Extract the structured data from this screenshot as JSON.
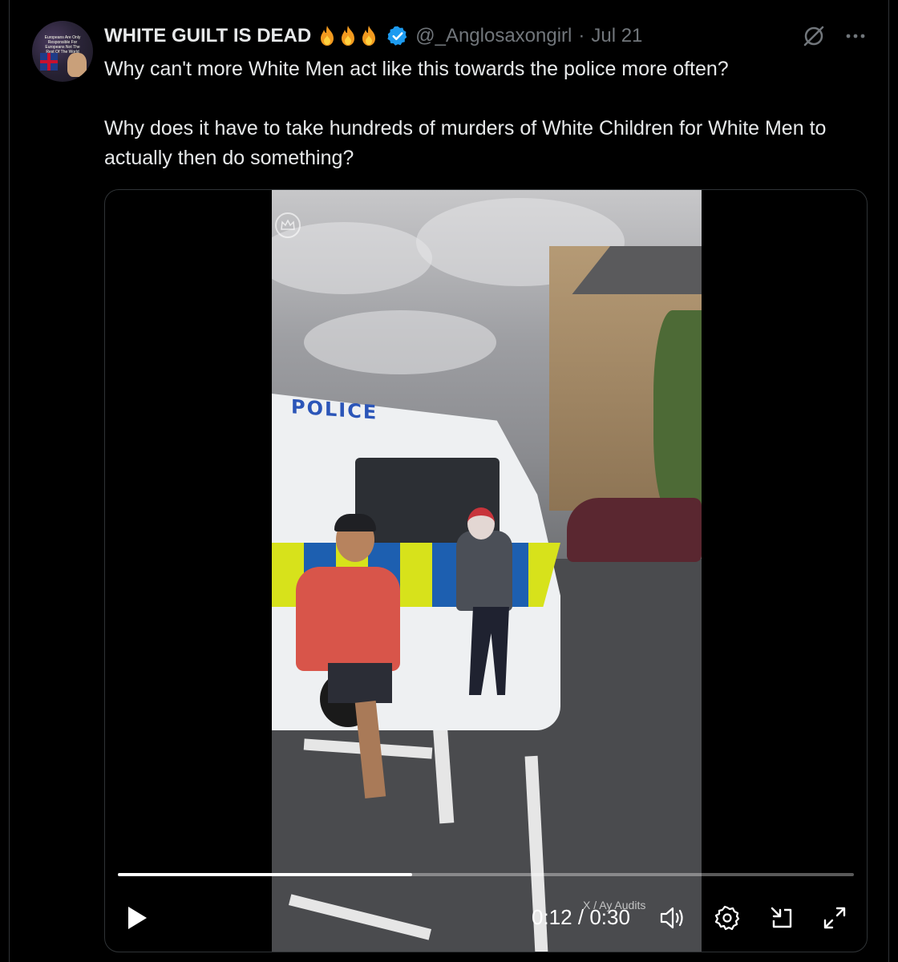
{
  "post": {
    "author": {
      "display_name": "WHITE GUILT IS DEAD",
      "emoji": [
        "fire",
        "fire",
        "fire"
      ],
      "verified": true,
      "handle": "@_Anglosaxongirl",
      "separator": "·",
      "date": "Jul 21"
    },
    "text": [
      "Why can't more White Men act like this towards the police more often?",
      "Why does it have to take hundreds of murders of White Children for White Men to actually then do something?"
    ],
    "avatar_text": "Europeans Are Only Responsible For Europeans Not The Rest Of The World",
    "tools": [
      "grok-icon",
      "more-icon"
    ]
  },
  "video": {
    "scene_text": "POLICE",
    "watermark": "X / Ay Audits",
    "current_time": "0:12",
    "separator": "/",
    "duration": "0:30",
    "progress": 0.4,
    "controls": [
      "play-icon",
      "volume-icon",
      "settings-icon",
      "dock-icon",
      "fullscreen-icon"
    ]
  },
  "colors": {
    "background": "#000000",
    "text": "#e7e9ea",
    "secondary_text": "#71767b",
    "verified": "#1d9bf0",
    "border": "#2f3336"
  }
}
